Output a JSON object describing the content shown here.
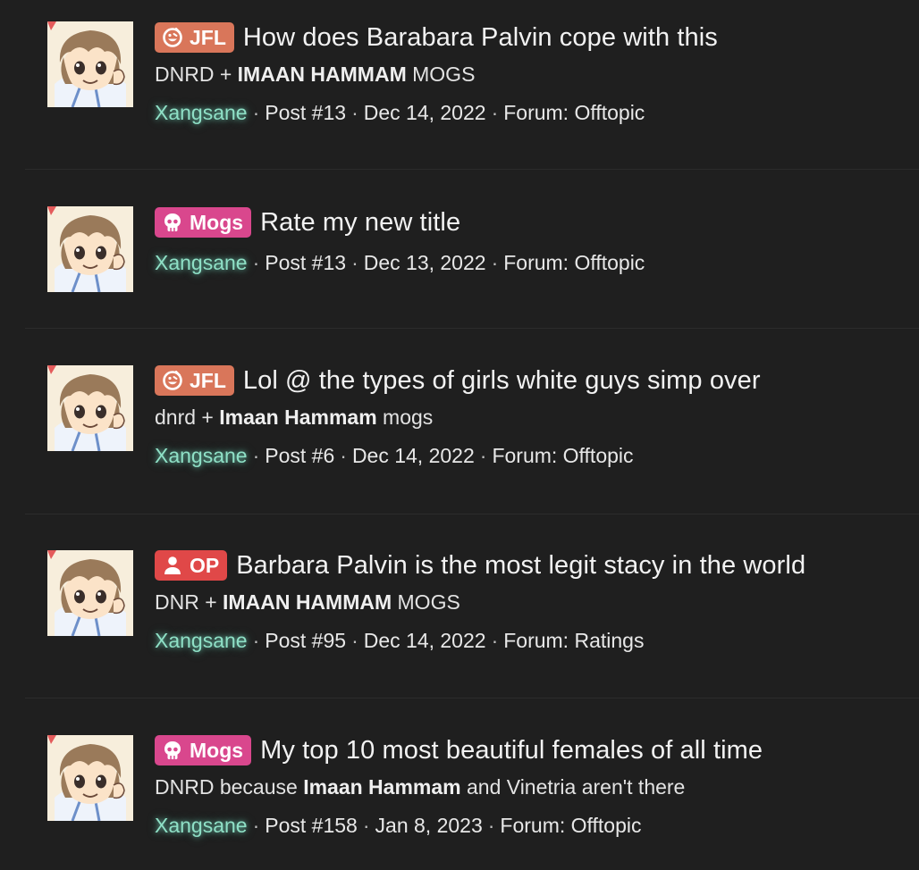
{
  "colors": {
    "background": "#1f1f1f",
    "username": "#8fe0c6",
    "badge_jfl": "#d9765a",
    "badge_mogs": "#d9478d",
    "badge_op": "#e04848"
  },
  "results": [
    {
      "badge": {
        "label": "JFL",
        "icon": "jfl-smiley-icon",
        "color": "#d9765a"
      },
      "title": "How does Barabara Palvin cope with this",
      "snippet": {
        "before": "DNRD + ",
        "bold": "IMAAN HAMMAM",
        "after": " MOGS"
      },
      "author": "Xangsane",
      "post": "Post #13",
      "date": "Dec 14, 2022",
      "forum": "Forum: Offtopic"
    },
    {
      "badge": {
        "label": "Mogs",
        "icon": "skull-icon",
        "color": "#d9478d"
      },
      "title": "Rate my new title",
      "snippet": null,
      "author": "Xangsane",
      "post": "Post #13",
      "date": "Dec 13, 2022",
      "forum": "Forum: Offtopic"
    },
    {
      "badge": {
        "label": "JFL",
        "icon": "jfl-smiley-icon",
        "color": "#d9765a"
      },
      "title": "Lol @ the types of girls white guys simp over",
      "snippet": {
        "before": "dnrd + ",
        "bold": "Imaan Hammam",
        "after": " mogs"
      },
      "author": "Xangsane",
      "post": "Post #6",
      "date": "Dec 14, 2022",
      "forum": "Forum: Offtopic"
    },
    {
      "badge": {
        "label": "OP",
        "icon": "user-icon",
        "color": "#e04848"
      },
      "title": "Barbara Palvin is the most legit stacy in the world",
      "snippet": {
        "before": "DNR + ",
        "bold": "IMAAN HAMMAM",
        "after": " MOGS"
      },
      "author": "Xangsane",
      "post": "Post #95",
      "date": "Dec 14, 2022",
      "forum": "Forum: Ratings"
    },
    {
      "badge": {
        "label": "Mogs",
        "icon": "skull-icon",
        "color": "#d9478d"
      },
      "title": "My top 10 most beautiful females of all time",
      "snippet": {
        "before": "DNRD because ",
        "bold": "Imaan Hammam",
        "after": " and Vinetria aren't there"
      },
      "author": "Xangsane",
      "post": "Post #158",
      "date": "Jan 8, 2023",
      "forum": "Forum: Offtopic"
    }
  ]
}
